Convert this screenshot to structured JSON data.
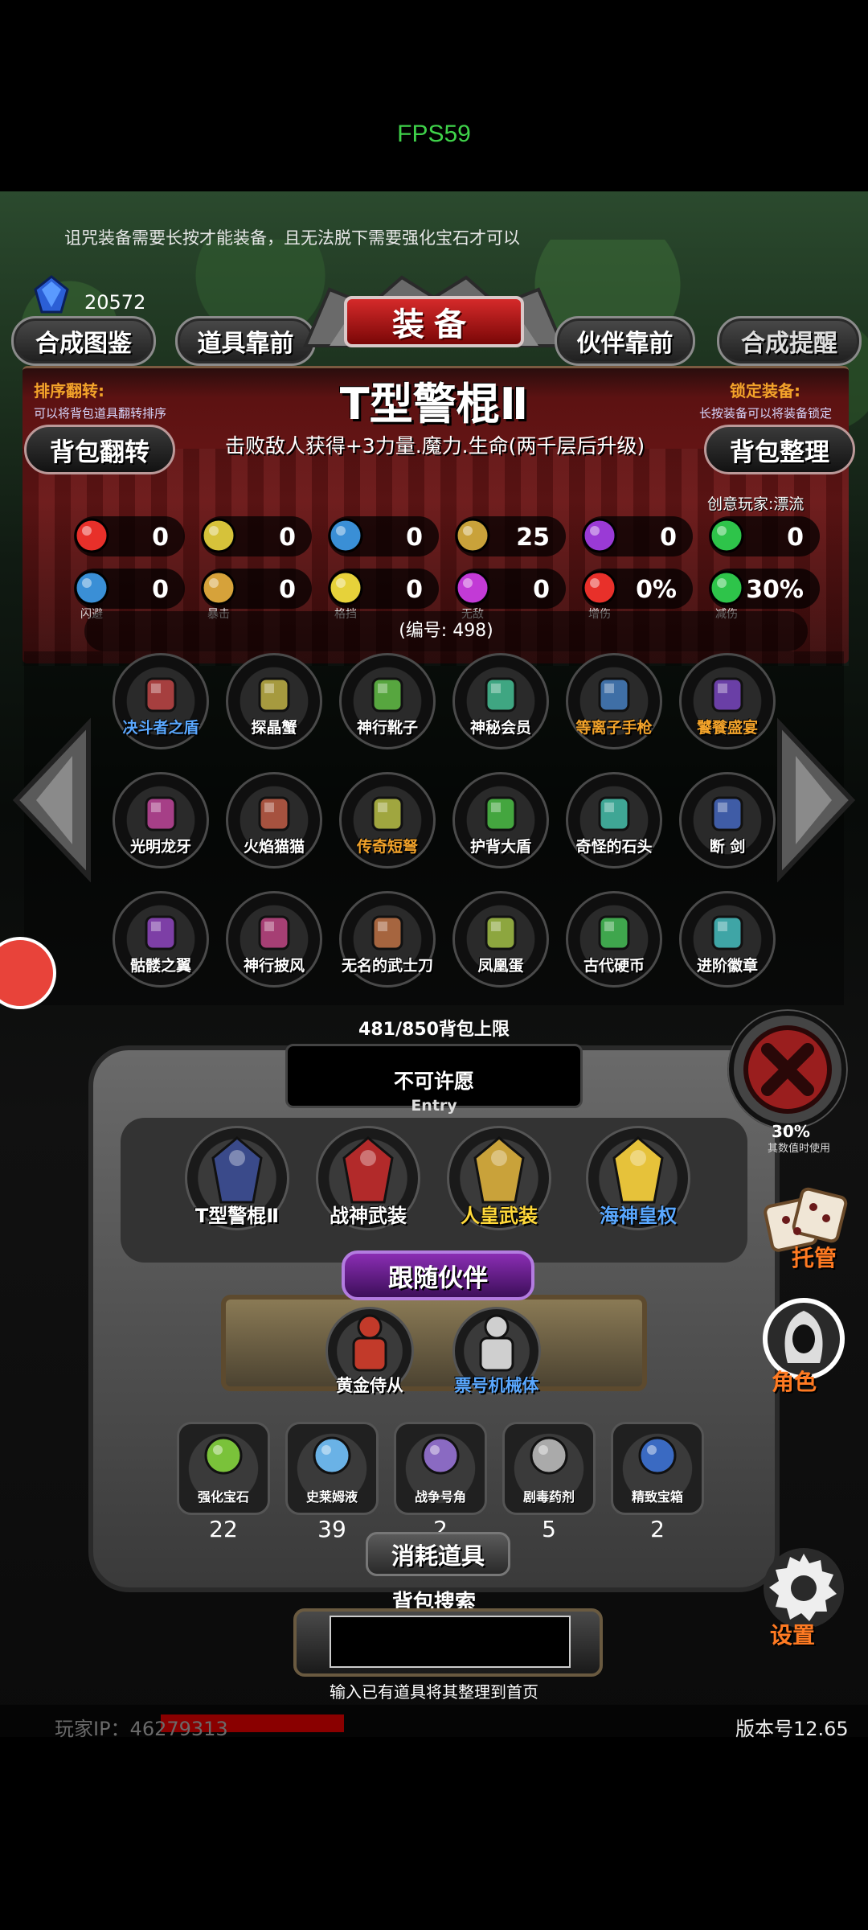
{
  "fps": "FPS59",
  "notice": "诅咒装备需要长按才能装备，且无法脱下需要强化宝石才可以",
  "gem_count": "20572",
  "tabs": {
    "compose_atlas": "合成图鉴",
    "items_front": "道具靠前",
    "title": "装备",
    "partner_front": "伙伴靠前",
    "compose_remind": "合成提醒"
  },
  "sort": {
    "label": "排序翻转:",
    "hint": "可以将背包道具翻转排序"
  },
  "lock": {
    "label": "锁定装备:",
    "hint": "长按装备可以将装备锁定"
  },
  "item": {
    "name": "T型警棍Ⅱ",
    "desc": "击败敌人获得+3力量.魔力.生命(两千层后升级)",
    "creator": "创意玩家:漂流",
    "serial": "(编号: 498)"
  },
  "buttons": {
    "bag_flip": "背包翻转",
    "bag_sort": "背包整理"
  },
  "stats_row1": [
    {
      "icon": "heart-icon",
      "value": "0",
      "color": "#e8302a"
    },
    {
      "icon": "strength-icon",
      "value": "0",
      "color": "#d6c23a"
    },
    {
      "icon": "helmet-icon",
      "value": "0",
      "color": "#3a8fd6"
    },
    {
      "icon": "attack-icon",
      "value": "25",
      "color": "#c9a23a"
    },
    {
      "icon": "magic-icon",
      "value": "0",
      "color": "#9a3ad6"
    },
    {
      "icon": "luck-icon",
      "value": "0",
      "color": "#2ec44a"
    }
  ],
  "stats_row2": [
    {
      "icon": "dodge-icon",
      "value": "0",
      "caption": "闪避",
      "color": "#3a8fd6"
    },
    {
      "icon": "crit-icon",
      "value": "0",
      "caption": "暴击",
      "color": "#d6a23a"
    },
    {
      "icon": "block-icon",
      "value": "0",
      "caption": "格挡",
      "color": "#e6d23a"
    },
    {
      "icon": "invincible-icon",
      "value": "0",
      "caption": "无敌",
      "color": "#c23ad6"
    },
    {
      "icon": "damage-up-icon",
      "value": "0%",
      "caption": "增伤",
      "color": "#e8302a"
    },
    {
      "icon": "damage-reduce-icon",
      "value": "30%",
      "caption": "减伤",
      "color": "#2ec44a"
    }
  ],
  "inventory": [
    {
      "label": "决斗者之盾",
      "color": "#5aa8ff",
      "icon": "shield-icon"
    },
    {
      "label": "探晶蟹",
      "color": "#ffffff",
      "icon": "crab-icon"
    },
    {
      "label": "神行靴子",
      "color": "#ffffff",
      "icon": "boots-icon"
    },
    {
      "label": "神秘会员",
      "color": "#ffffff",
      "icon": "card-icon"
    },
    {
      "label": "等离子手枪",
      "color": "#f3a32a",
      "icon": "pistol-icon"
    },
    {
      "label": "饕餮盛宴",
      "color": "#f3a32a",
      "icon": "feast-icon"
    },
    {
      "label": "光明龙牙",
      "color": "#ffffff",
      "icon": "fang-icon"
    },
    {
      "label": "火焰猫猫",
      "color": "#ffffff",
      "icon": "cat-icon"
    },
    {
      "label": "传奇短弩",
      "color": "#f3a32a",
      "icon": "crossbow-icon"
    },
    {
      "label": "护背大盾",
      "color": "#ffffff",
      "icon": "tower-shield-icon"
    },
    {
      "label": "奇怪的石头",
      "color": "#ffffff",
      "icon": "stone-icon"
    },
    {
      "label": "断 剑",
      "color": "#ffffff",
      "icon": "broken-sword-icon"
    },
    {
      "label": "骷髅之翼",
      "color": "#ffffff",
      "icon": "wings-icon"
    },
    {
      "label": "神行披风",
      "color": "#ffffff",
      "icon": "cloak-icon"
    },
    {
      "label": "无名的武士刀",
      "color": "#ffffff",
      "icon": "katana-icon"
    },
    {
      "label": "凤凰蛋",
      "color": "#ffffff",
      "icon": "egg-icon"
    },
    {
      "label": "古代硬币",
      "color": "#ffffff",
      "icon": "coin-icon"
    },
    {
      "label": "进阶徽章",
      "color": "#ffffff",
      "icon": "badge-icon"
    }
  ],
  "capacity": "481/850背包上限",
  "wish": {
    "title": "不可许愿",
    "subtitle": "Entry",
    "slots": [
      {
        "label": "T型警棍Ⅱ",
        "color": "#ffffff"
      },
      {
        "label": "战神武装",
        "color": "#ffffff"
      },
      {
        "label": "人皇武装",
        "color": "#ffd93a"
      },
      {
        "label": "海神皇权",
        "color": "#5aa8ff"
      }
    ]
  },
  "partner": {
    "banner": "跟随伙伴",
    "slots": [
      {
        "label": "黄金侍从",
        "color": "#ffffff"
      },
      {
        "label": "票号机械体",
        "color": "#5aa8ff"
      }
    ]
  },
  "consumables": [
    {
      "label": "强化宝石",
      "count": "22",
      "icon": "gem-green-icon"
    },
    {
      "label": "史莱姆液",
      "count": "39",
      "icon": "potion-icon"
    },
    {
      "label": "战争号角",
      "count": "2",
      "icon": "horn-icon"
    },
    {
      "label": "剧毒药剂",
      "count": "5",
      "icon": "poison-icon"
    },
    {
      "label": "精致宝箱",
      "count": "2",
      "icon": "chest-icon"
    }
  ],
  "consume_banner": "消耗道具",
  "search": {
    "title": "背包搜索",
    "placeholder": "",
    "hint": "输入已有道具将其整理到首页"
  },
  "right_menu": {
    "usage_pct": "30%",
    "usage_caption": "其数值时使用",
    "hosting": "托管",
    "role": "角色",
    "settings": "设置"
  },
  "footer": {
    "player_ip": "玩家IP：46279313",
    "version": "版本号12.65"
  }
}
